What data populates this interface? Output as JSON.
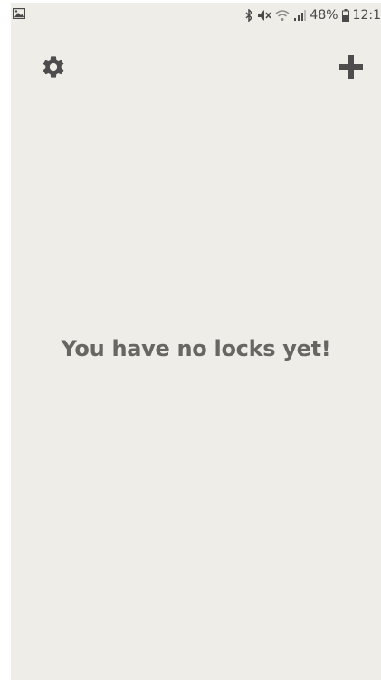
{
  "status_bar": {
    "battery_percent": "48%",
    "time": "12:1",
    "icons": [
      "gallery-icon",
      "bluetooth-icon",
      "mute-icon",
      "wifi-icon",
      "signal-icon",
      "battery-icon"
    ]
  },
  "app_bar": {
    "left_icon": "gear-icon",
    "right_icon": "plus-icon"
  },
  "main": {
    "empty_message": "You have no locks yet!"
  },
  "colors": {
    "background": "#efede8",
    "icon": "#4d4d4d",
    "text": "#666663"
  }
}
